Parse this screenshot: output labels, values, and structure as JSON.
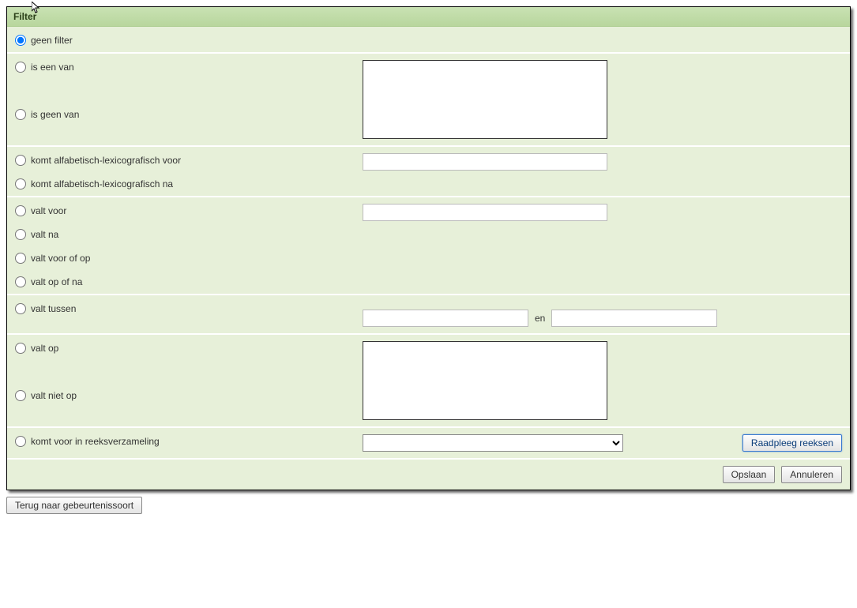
{
  "header": {
    "title": "Filter"
  },
  "options": {
    "geen_filter": "geen filter",
    "is_een_van": "is een van",
    "is_geen_van": "is geen van",
    "alfabet_voor": "komt alfabetisch-lexicografisch voor",
    "alfabet_na": "komt alfabetisch-lexicografisch na",
    "valt_voor": "valt voor",
    "valt_na": "valt na",
    "valt_voor_of_op": "valt voor of op",
    "valt_op_of_na": "valt op of na",
    "valt_tussen": "valt tussen",
    "tussen_and": "en",
    "valt_op": "valt op",
    "valt_niet_op": "valt niet op",
    "reeks": "komt voor in reeksverzameling"
  },
  "buttons": {
    "raadpleeg": "Raadpleeg reeksen",
    "opslaan": "Opslaan",
    "annuleren": "Annuleren",
    "terug": "Terug naar gebeurtenissoort"
  },
  "fields": {
    "list1": "",
    "alfabet_value": "",
    "valt_value": "",
    "tussen_from": "",
    "tussen_to": "",
    "list2": "",
    "reeks_select": ""
  }
}
